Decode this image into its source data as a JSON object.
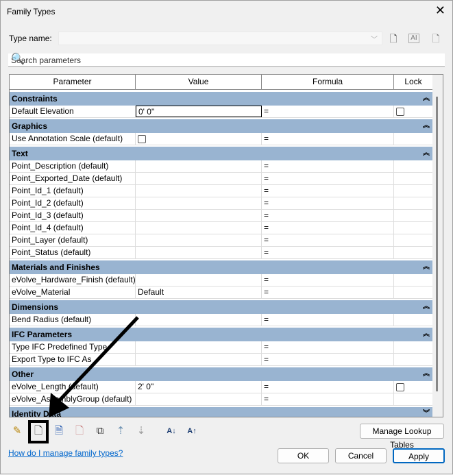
{
  "window": {
    "title": "Family Types",
    "close": "✕"
  },
  "type_name": {
    "label": "Type name:",
    "value": ""
  },
  "search": {
    "placeholder": "Search parameters"
  },
  "columns": [
    "Parameter",
    "Value",
    "Formula",
    "Lock"
  ],
  "groups": [
    {
      "name": "Constraints",
      "rows": [
        {
          "p": "Default Elevation",
          "v": "0'  0\"",
          "f": "=",
          "lock": true,
          "vbox": true
        }
      ]
    },
    {
      "name": "Graphics",
      "rows": [
        {
          "p": "Use Annotation Scale (default)",
          "v": "",
          "vcheck": true,
          "f": "="
        }
      ]
    },
    {
      "name": "Text",
      "rows": [
        {
          "p": "Point_Description (default)",
          "v": "",
          "f": "="
        },
        {
          "p": "Point_Exported_Date (default)",
          "v": "",
          "f": "="
        },
        {
          "p": "Point_Id_1 (default)",
          "v": "",
          "f": "="
        },
        {
          "p": "Point_Id_2 (default)",
          "v": "",
          "f": "="
        },
        {
          "p": "Point_Id_3 (default)",
          "v": "",
          "f": "="
        },
        {
          "p": "Point_Id_4 (default)",
          "v": "",
          "f": "="
        },
        {
          "p": "Point_Layer (default)",
          "v": "",
          "f": "="
        },
        {
          "p": "Point_Status (default)",
          "v": "",
          "f": "="
        }
      ]
    },
    {
      "name": "Materials and Finishes",
      "rows": [
        {
          "p": "eVolve_Hardware_Finish (default)",
          "v": "",
          "f": "="
        },
        {
          "p": "eVolve_Material",
          "v": "Default",
          "f": "="
        }
      ]
    },
    {
      "name": "Dimensions",
      "rows": [
        {
          "p": "Bend Radius (default)",
          "v": "",
          "f": "="
        }
      ]
    },
    {
      "name": "IFC Parameters",
      "rows": [
        {
          "p": "Type IFC Predefined Type",
          "v": "",
          "f": "="
        },
        {
          "p": "Export Type to IFC As",
          "v": "",
          "f": "="
        }
      ]
    },
    {
      "name": "Other",
      "rows": [
        {
          "p": "eVolve_Length (default)",
          "v": "2'  0\"",
          "f": "=",
          "lock": true
        },
        {
          "p": "eVolve_AssemblyGroup (default)",
          "v": "",
          "f": "="
        }
      ]
    },
    {
      "name": "Identity Data",
      "rows": [],
      "collapsed": true
    }
  ],
  "buttons": {
    "manage_lookup": "Manage Lookup Tables",
    "ok": "OK",
    "cancel": "Cancel",
    "apply": "Apply"
  },
  "help_link": "How do I manage family types?"
}
